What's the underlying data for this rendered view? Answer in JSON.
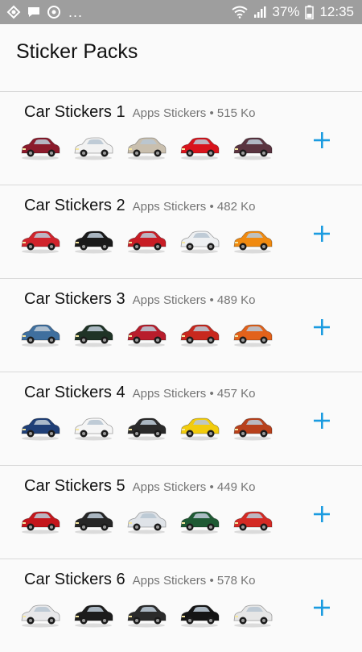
{
  "status_bar": {
    "dots": "...",
    "battery": "37%",
    "time": "12:35",
    "icons": [
      "app-icon",
      "chat-icon",
      "browser-icon",
      "wifi-icon",
      "signal-icon",
      "battery-icon"
    ]
  },
  "header": {
    "title": "Sticker Packs"
  },
  "colors": {
    "accent": "#1a9be0",
    "status_bar": "#9e9e9e",
    "divider": "#d9d9d9"
  },
  "packs": [
    {
      "name": "Car Stickers 1",
      "publisher": "Apps Stickers",
      "separator": "•",
      "size": "515 Ko",
      "sticker_colors": [
        "#8b1a2b",
        "#f2f2f2",
        "#c9bfae",
        "#d8141c",
        "#5a3440"
      ],
      "add_icon": "plus-icon"
    },
    {
      "name": "Car Stickers 2",
      "publisher": "Apps Stickers",
      "separator": "•",
      "size": "482 Ko",
      "sticker_colors": [
        "#d0242c",
        "#1a1a1a",
        "#c81d25",
        "#eef0f2",
        "#f08a10"
      ],
      "add_icon": "plus-icon"
    },
    {
      "name": "Car Stickers 3",
      "publisher": "Apps Stickers",
      "separator": "•",
      "size": "489 Ko",
      "sticker_colors": [
        "#3f6f9e",
        "#1f3326",
        "#b81d2c",
        "#c8281e",
        "#e2621b"
      ],
      "add_icon": "plus-icon"
    },
    {
      "name": "Car Stickers 4",
      "publisher": "Apps Stickers",
      "separator": "•",
      "size": "457 Ko",
      "sticker_colors": [
        "#1f3f77",
        "#f5f5f5",
        "#2a2a2a",
        "#f2cc0d",
        "#b8401b"
      ],
      "add_icon": "plus-icon"
    },
    {
      "name": "Car Stickers 5",
      "publisher": "Apps Stickers",
      "separator": "•",
      "size": "449 Ko",
      "sticker_colors": [
        "#c4161c",
        "#262626",
        "#dfe3e8",
        "#1f5a34",
        "#d42a24"
      ],
      "add_icon": "plus-icon"
    },
    {
      "name": "Car Stickers 6",
      "publisher": "Apps Stickers",
      "separator": "•",
      "size": "578 Ko",
      "sticker_colors": [
        "#e8e8ea",
        "#1c1c1c",
        "#2b2b2b",
        "#151515",
        "#e6e6e6"
      ],
      "add_icon": "plus-icon"
    }
  ]
}
